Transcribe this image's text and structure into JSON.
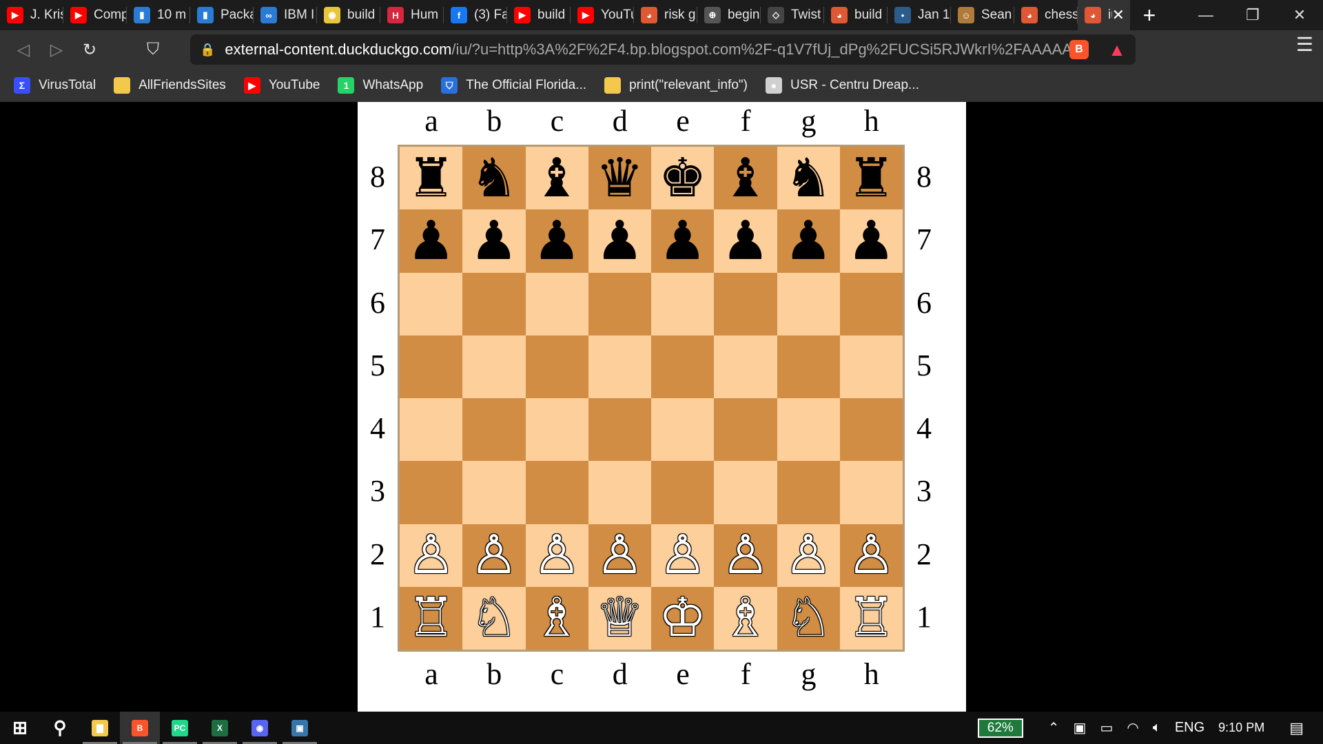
{
  "tabs": [
    {
      "title": "J. Kris",
      "icon": "youtube-icon",
      "color": "#ff0000",
      "glyph": "▶"
    },
    {
      "title": "Comp",
      "icon": "youtube-icon",
      "color": "#ff0000",
      "glyph": "▶"
    },
    {
      "title": "10 m",
      "icon": "packt-icon",
      "color": "#2a7bd4",
      "glyph": "▮"
    },
    {
      "title": "Packa",
      "icon": "packt-icon",
      "color": "#2a7bd4",
      "glyph": "▮"
    },
    {
      "title": "IBM I",
      "icon": "coursera-icon",
      "color": "#2a7bd4",
      "glyph": "∞"
    },
    {
      "title": "build",
      "icon": "stackshare-icon",
      "color": "#e8c63a",
      "glyph": "◉"
    },
    {
      "title": "Hum",
      "icon": "h-icon",
      "color": "#d7263d",
      "glyph": "H"
    },
    {
      "title": "(3) Fa",
      "icon": "facebook-icon",
      "color": "#1877f2",
      "glyph": "f"
    },
    {
      "title": "build",
      "icon": "youtube-icon",
      "color": "#ff0000",
      "glyph": "▶"
    },
    {
      "title": "YouTu",
      "icon": "youtube-icon",
      "color": "#ff0000",
      "glyph": "▶"
    },
    {
      "title": "risk g",
      "icon": "duckduckgo-icon",
      "color": "#de5833",
      "glyph": "◕"
    },
    {
      "title": "begin",
      "icon": "globe-icon",
      "color": "#555555",
      "glyph": "⊕"
    },
    {
      "title": "Twist",
      "icon": "diamond-icon",
      "color": "#444444",
      "glyph": "◇"
    },
    {
      "title": "build",
      "icon": "duckduckgo-icon",
      "color": "#de5833",
      "glyph": "◕"
    },
    {
      "title": "Jan 1",
      "icon": "dot-icon",
      "color": "#2b5d8a",
      "glyph": "•"
    },
    {
      "title": "Sean",
      "icon": "avatar-icon",
      "color": "#b07a3a",
      "glyph": "☺"
    },
    {
      "title": "chess",
      "icon": "duckduckgo-icon",
      "color": "#de5833",
      "glyph": "◕"
    },
    {
      "title": "iu",
      "icon": "duckduckgo-icon",
      "color": "#de5833",
      "glyph": "◕",
      "active": true
    }
  ],
  "new_tab": "+",
  "window_controls": {
    "minimize": "—",
    "restore": "❐",
    "close": "✕"
  },
  "nav": {
    "back": "◁",
    "forward": "▷",
    "reload": "↻",
    "bookmark": "⛉",
    "lock": "🔒",
    "menu": "☰"
  },
  "url": {
    "host": "external-content.duckduckgo.com",
    "rest": "/iu/?u=http%3A%2F%2F4.bp.blogspot.com%2F-q1V7fUj_dPg%2FUCSi5RJWkrI%2FAAAAAAAA..."
  },
  "brave_shield": "B",
  "brave_rewards": "▲",
  "bookmarks": [
    {
      "label": "VirusTotal",
      "icon": "virustotal-icon",
      "color": "#394eff",
      "glyph": "Σ"
    },
    {
      "label": "AllFriendsSites",
      "icon": "folder-icon",
      "color": "#f2c94c",
      "glyph": ""
    },
    {
      "label": "YouTube",
      "icon": "youtube-icon",
      "color": "#ff0000",
      "glyph": "▶"
    },
    {
      "label": "WhatsApp",
      "icon": "whatsapp-icon",
      "color": "#25d366",
      "glyph": "1"
    },
    {
      "label": "The Official Florida...",
      "icon": "shield-icon",
      "color": "#2a6fdb",
      "glyph": "⛉"
    },
    {
      "label": "print(\"relevant_info\")",
      "icon": "folder-icon",
      "color": "#f2c94c",
      "glyph": ""
    },
    {
      "label": "USR - Centru Dreap...",
      "icon": "globe-icon",
      "color": "#d0d0d0",
      "glyph": "●"
    }
  ],
  "chess": {
    "files": [
      "a",
      "b",
      "c",
      "d",
      "e",
      "f",
      "g",
      "h"
    ],
    "ranks": [
      "8",
      "7",
      "6",
      "5",
      "4",
      "3",
      "2",
      "1"
    ],
    "colors": {
      "light": "#fdcf9b",
      "dark": "#d18d44"
    },
    "position": [
      [
        "bR",
        "bN",
        "bB",
        "bQ",
        "bK",
        "bB",
        "bN",
        "bR"
      ],
      [
        "bP",
        "bP",
        "bP",
        "bP",
        "bP",
        "bP",
        "bP",
        "bP"
      ],
      [
        "",
        "",
        "",
        "",
        "",
        "",
        "",
        ""
      ],
      [
        "",
        "",
        "",
        "",
        "",
        "",
        "",
        ""
      ],
      [
        "",
        "",
        "",
        "",
        "",
        "",
        "",
        ""
      ],
      [
        "",
        "",
        "",
        "",
        "",
        "",
        "",
        ""
      ],
      [
        "wP",
        "wP",
        "wP",
        "wP",
        "wP",
        "wP",
        "wP",
        "wP"
      ],
      [
        "wR",
        "wN",
        "wB",
        "wQ",
        "wK",
        "wB",
        "wN",
        "wR"
      ]
    ]
  },
  "taskbar": {
    "apps": [
      {
        "name": "start-button",
        "glyph": "⊞",
        "color": "#ffffff"
      },
      {
        "name": "search-icon",
        "glyph": "⚲",
        "color": "#ffffff"
      },
      {
        "name": "file-explorer-icon",
        "glyph": "▇",
        "color": "#f2c94c",
        "open": true
      },
      {
        "name": "brave-icon",
        "glyph": "B",
        "color": "#fb542b",
        "open": true,
        "active": true
      },
      {
        "name": "pycharm-icon",
        "glyph": "PC",
        "color": "#21d789",
        "open": true
      },
      {
        "name": "excel-icon",
        "glyph": "X",
        "color": "#1d6f42",
        "open": true
      },
      {
        "name": "discord-icon",
        "glyph": "◉",
        "color": "#5865f2",
        "open": true
      },
      {
        "name": "python-icon",
        "glyph": "▣",
        "color": "#3776ab",
        "open": true
      }
    ],
    "battery": "62%",
    "language": "ENG",
    "time": "9:10 PM"
  }
}
